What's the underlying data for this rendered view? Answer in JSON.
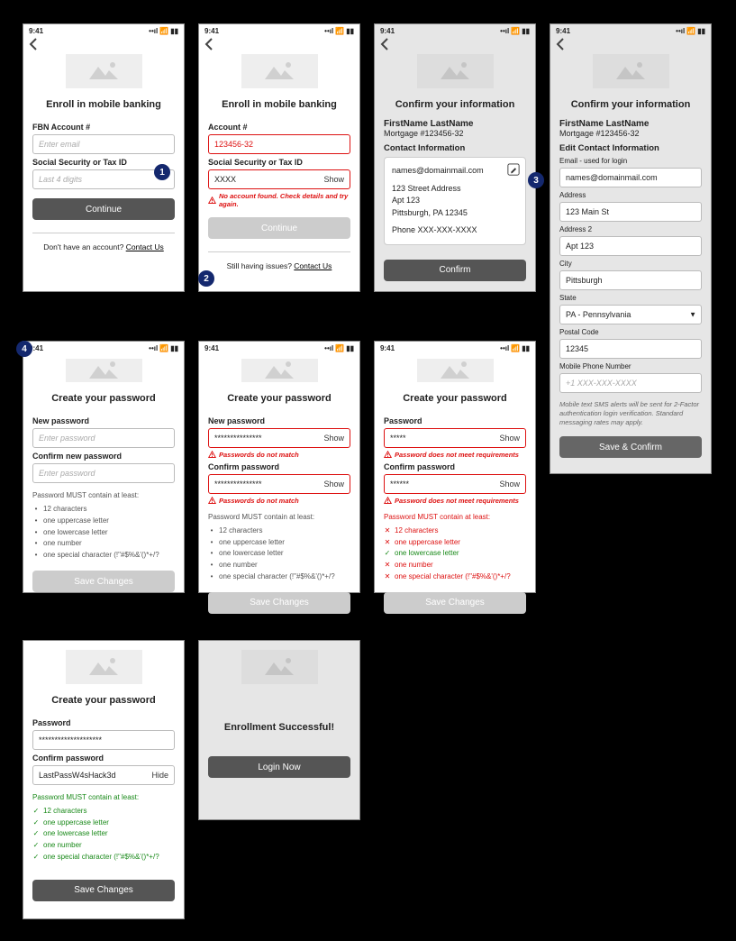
{
  "statusTime": "9:41",
  "annotations": {
    "a1": "1",
    "a2": "2",
    "a3": "3",
    "a4": "4"
  },
  "screen1": {
    "title": "Enroll in mobile banking",
    "acctLabel": "FBN Account #",
    "acctPh": "Enter email",
    "ssnLabel": "Social Security or Tax ID",
    "ssnPh": "Last 4 digits",
    "continue": "Continue",
    "footer_pre": "Don't have an account? ",
    "footer_link": "Contact Us"
  },
  "screen2": {
    "title": "Enroll in mobile banking",
    "acctLabel": "Account #",
    "acctVal": "123456-32",
    "ssnLabel": "Social Security or Tax ID",
    "ssnVal": "XXXX",
    "show": "Show",
    "err": "No account found. Check details and try again.",
    "continue": "Continue",
    "footer_pre": "Still having issues? ",
    "footer_link": "Contact Us"
  },
  "screen3": {
    "title": "Confirm your information",
    "name": "FirstName LastName",
    "mortgage": "Mortgage #123456-32",
    "contactHeader": "Contact Information",
    "email": "names@domainmail.com",
    "addr1": "123 Street Address",
    "addr2": "Apt 123",
    "cityLine": "Pittsburgh, PA 12345",
    "phone": "Phone XXX-XXX-XXXX",
    "confirm": "Confirm"
  },
  "screen4": {
    "title": "Confirm your information",
    "name": "FirstName LastName",
    "mortgage": "Mortgage #123456-32",
    "editHeader": "Edit Contact Information",
    "emailLabel": "Email - used for login",
    "emailVal": "names@domainmail.com",
    "addrLabel": "Address",
    "addrVal": "123 Main St",
    "addr2Label": "Address 2",
    "addr2Val": "Apt 123",
    "cityLabel": "City",
    "cityVal": "Pittsburgh",
    "stateLabel": "State",
    "stateVal": "PA - Pennsylvania",
    "zipLabel": "Postal Code",
    "zipVal": "12345",
    "phoneLabel": "Mobile Phone Number",
    "phonePh": "+1 XXX-XXX-XXXX",
    "note": "Mobile text SMS alerts will be sent for 2-Factor authentication login verification. Standard messaging rates may apply.",
    "save": "Save & Confirm"
  },
  "screen5": {
    "title": "Create your password",
    "newLabel": "New password",
    "newPh": "Enter password",
    "confLabel": "Confirm new password",
    "confPh": "Enter password",
    "rulesHeader": "Password MUST contain at least:",
    "r1": "12 characters",
    "r2": "one uppercase letter",
    "r3": "one lowercase letter",
    "r4": "one number",
    "r5": "one special character (!\"#$%&'()*+/?",
    "save": "Save Changes"
  },
  "screen6": {
    "title": "Create your password",
    "newLabel": "New password",
    "newVal": "***************",
    "show": "Show",
    "err": "Passwords do not match",
    "confLabel": "Confirm password",
    "confVal": "***************",
    "rulesHeader": "Password MUST contain at least:",
    "r1": "12 characters",
    "r2": "one uppercase letter",
    "r3": "one lowercase letter",
    "r4": "one number",
    "r5": "one special character (!\"#$%&'()*+/?",
    "save": "Save Changes"
  },
  "screen7": {
    "title": "Create your password",
    "newLabel": "Password",
    "newVal": "*****",
    "show": "Show",
    "err": "Password does not meet requirements",
    "confLabel": "Confirm password",
    "confVal": "******",
    "rulesHeader": "Password MUST contain at least:",
    "r1": "12 characters",
    "r2": "one uppercase letter",
    "r3": "one lowercase letter",
    "r4": "one number",
    "r5": "one special character (!\"#$%&'()*+/?",
    "save": "Save Changes"
  },
  "screen8": {
    "title": "Create your password",
    "newLabel": "Password",
    "newVal": "********************",
    "confLabel": "Confirm password",
    "confVal": "LastPassW4sHack3d",
    "hide": "Hide",
    "rulesHeader": "Password MUST contain at least:",
    "r1": "12 characters",
    "r2": "one uppercase letter",
    "r3": "one lowercase letter",
    "r4": "one number",
    "r5": "one special character (!\"#$%&'()*+/?",
    "save": "Save Changes"
  },
  "screen9": {
    "title": "Enrollment Successful!",
    "login": "Login Now"
  }
}
